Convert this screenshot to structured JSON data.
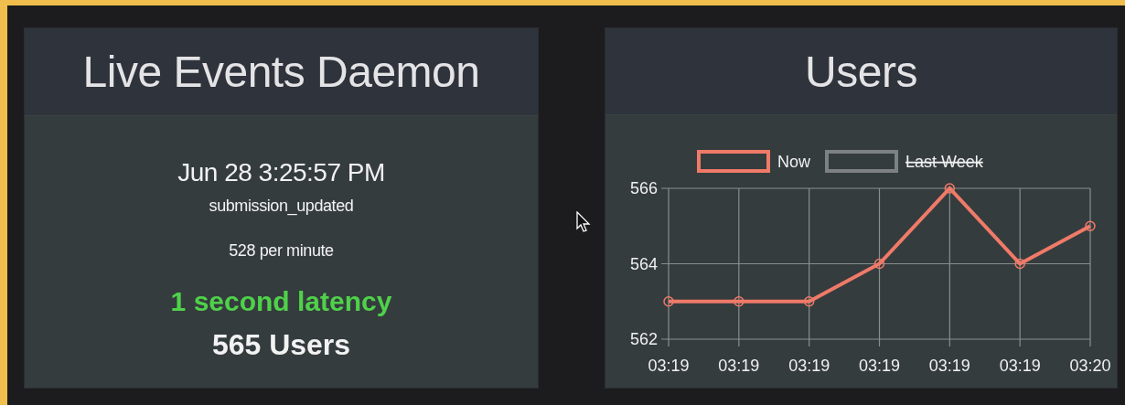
{
  "panels": [
    {
      "title": "Live Events Daemon",
      "stats": [
        {
          "kind": "timestamp",
          "text": "Jun 28 3:25:57 PM"
        },
        {
          "kind": "event",
          "text": "submission_updated"
        },
        {
          "kind": "rate",
          "text": "528 per minute"
        },
        {
          "kind": "latency",
          "text": "1 second latency",
          "color": "#4fd14a"
        },
        {
          "kind": "users",
          "text": "565 Users"
        }
      ]
    },
    {
      "title": "Users",
      "legend": [
        {
          "kind": "series",
          "color": "#f07a68",
          "hidden": false
        },
        {
          "kind": "label",
          "label": "Last Week",
          "color": "#7d8184",
          "hidden": true
        }
      ],
      "chart_data": {
        "type": "line",
        "categories": [
          "03:19",
          "03:19",
          "03:19",
          "03:19",
          "03:19",
          "03:19",
          "03:20"
        ],
        "series": [
          {
            "name": "Now",
            "color": "#f07a68",
            "values": [
              563,
              563,
              563,
              564,
              566,
              564,
              565
            ]
          }
        ],
        "ylim": [
          562,
          566
        ],
        "yticks": [
          562,
          564,
          566
        ],
        "grid": true,
        "marker": true
      }
    }
  ]
}
